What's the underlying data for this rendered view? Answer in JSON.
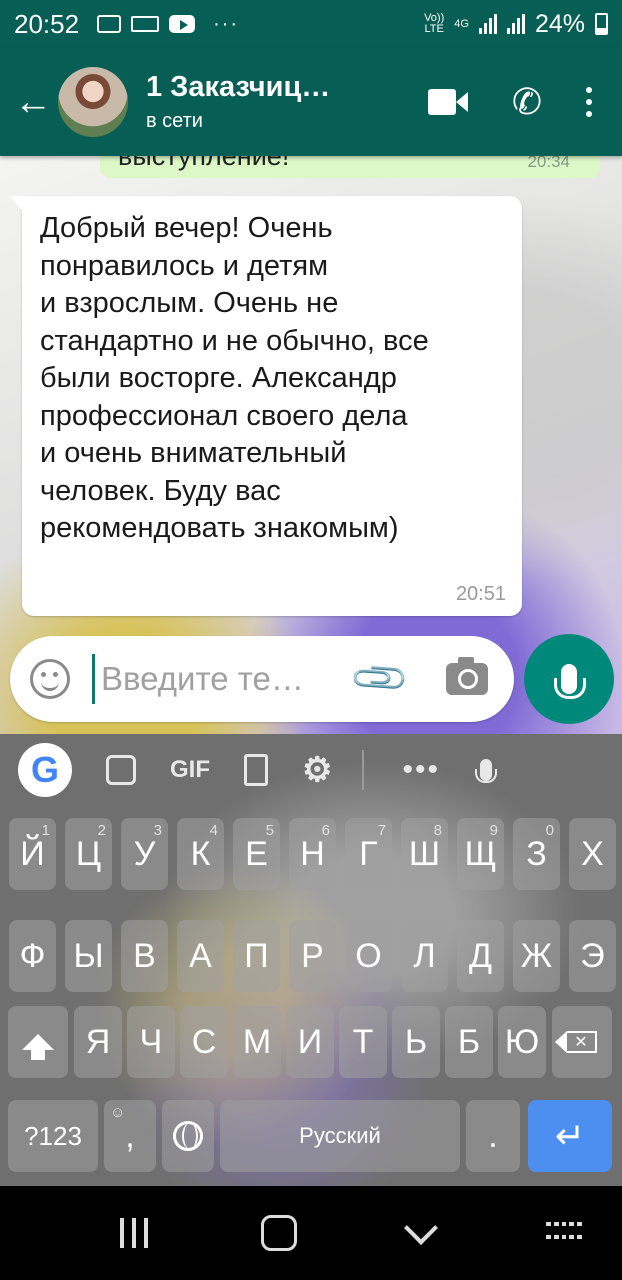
{
  "status_bar": {
    "time": "20:52",
    "more": "···",
    "volte": "Vo))\nLTE",
    "net": "4G",
    "battery": "24%"
  },
  "app_bar": {
    "title": "1 Заказчиц…",
    "status": "в сети",
    "back": "←",
    "phone": "✆"
  },
  "chat": {
    "prev_message": {
      "text": "выступление!",
      "time": "20:34"
    },
    "message": {
      "text": "Добрый вечер! Очень\nпонравилось и детям\nи взрослым. Очень не\nстандартно и не обычно, все\nбыли восторге. Александр\nпрофессионал своего дела\nи очень внимательный\nчеловек. Буду вас\nрекомендовать знакомым)",
      "time": "20:51"
    }
  },
  "composer": {
    "placeholder": "Введите те…",
    "attach": "📎"
  },
  "keyboard": {
    "toolbar": {
      "google": "G",
      "gif": "GIF",
      "gear": "⚙",
      "dots": "•••"
    },
    "row1": [
      "Й",
      "Ц",
      "У",
      "К",
      "Е",
      "Н",
      "Г",
      "Ш",
      "Щ",
      "З",
      "Х"
    ],
    "row1_hints": [
      "1",
      "2",
      "3",
      "4",
      "5",
      "6",
      "7",
      "8",
      "9",
      "0",
      ""
    ],
    "row2": [
      "Ф",
      "Ы",
      "В",
      "А",
      "П",
      "Р",
      "О",
      "Л",
      "Д",
      "Ж",
      "Э"
    ],
    "row3": [
      "Я",
      "Ч",
      "С",
      "М",
      "И",
      "Т",
      "Ь",
      "Б",
      "Ю"
    ],
    "symbols_key": "?123",
    "comma_key": ",",
    "comma_hint": "☺",
    "space_label": "Русский",
    "period_key": ".",
    "enter": "↵"
  },
  "colors": {
    "header": "#075e54",
    "bubble_in": "#ffffff",
    "bubble_out": "#dcf8c6",
    "fab": "#00897b",
    "enter_key": "#4d8ff0"
  }
}
